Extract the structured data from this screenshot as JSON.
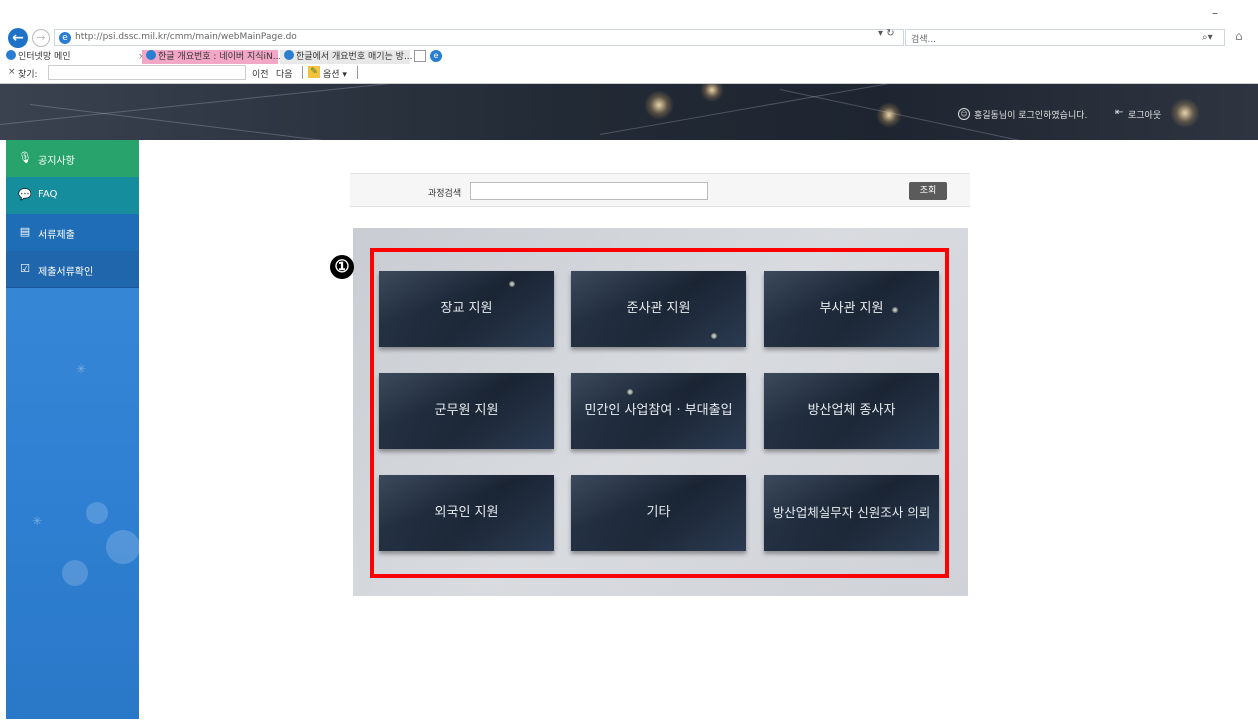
{
  "browser": {
    "url": "http://psi.dssc.mil.kr/cmm/main/webMainPage.do",
    "search_placeholder": "검색...",
    "tabs": [
      {
        "label": "인터넷망 메인"
      },
      {
        "label": "한글 개요번호 : 네이버 지식iN..."
      },
      {
        "label": "한글에서 개요번호 매기는 방..."
      }
    ],
    "find_bar": {
      "label": "찾기:",
      "prev": "이전",
      "next": "다음",
      "options": "옵션 ▾"
    }
  },
  "header": {
    "user_message": "홍길동님이 로그인하였습니다.",
    "logout_label": "로그아웃"
  },
  "sidebar": {
    "items": [
      {
        "label": "공지사항",
        "icon": "microphone-icon",
        "color": "#27a36b"
      },
      {
        "label": "FAQ",
        "icon": "chat-icon",
        "color": "#168d9d"
      },
      {
        "label": "서류제출",
        "icon": "document-submit-icon",
        "color": "#1f6db7"
      },
      {
        "label": "제출서류확인",
        "icon": "checklist-icon",
        "color": "#1f66ad"
      }
    ]
  },
  "search": {
    "label": "과정검색",
    "value": "",
    "button_label": "조회"
  },
  "annotation": {
    "marker": "①",
    "color": "#ff0000"
  },
  "tiles": [
    {
      "label": "장교 지원"
    },
    {
      "label": "준사관 지원"
    },
    {
      "label": "부사관 지원"
    },
    {
      "label": "군무원 지원"
    },
    {
      "label": "민간인 사업참여 · 부대출입"
    },
    {
      "label": "방산업체 종사자"
    },
    {
      "label": "외국인 지원"
    },
    {
      "label": "기타"
    },
    {
      "label": "방산업체실무자 신원조사 의뢰"
    }
  ]
}
